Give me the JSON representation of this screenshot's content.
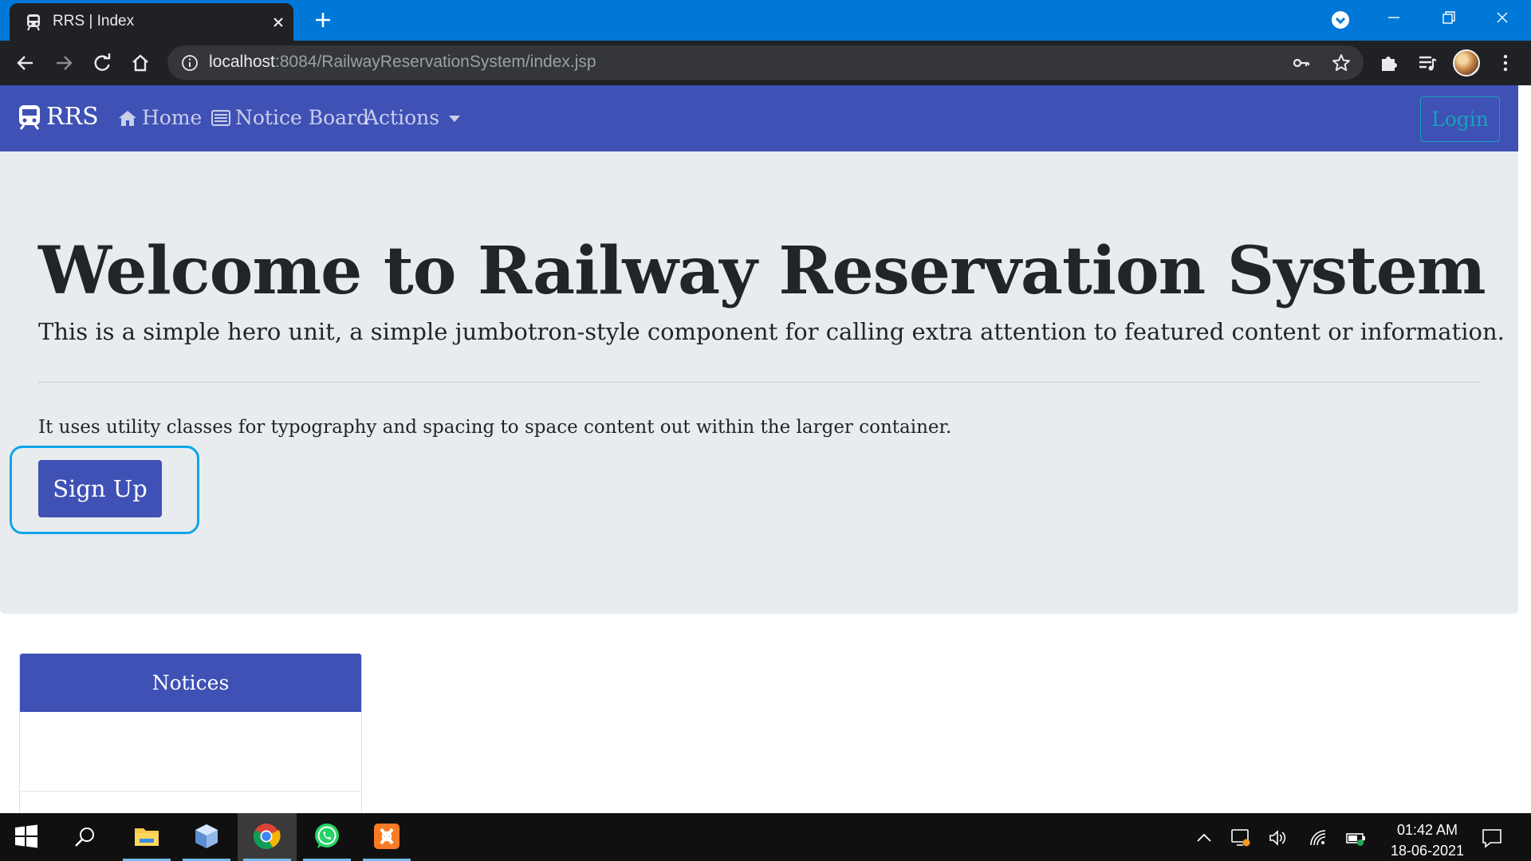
{
  "browser": {
    "tab_title": "RRS | Index",
    "url_host": "localhost",
    "url_rest": ":8084/RailwayReservationSystem/index.jsp"
  },
  "navbar": {
    "brand": "RRS",
    "links": [
      {
        "label": "Home",
        "icon": "home-icon"
      },
      {
        "label": "Notice Board",
        "icon": "list-alt-icon"
      },
      {
        "label": "Actions",
        "icon": "caret-down-icon"
      }
    ],
    "login_label": "Login"
  },
  "hero": {
    "title": "Welcome to Railway Reservation System",
    "lead": "This is a simple hero unit, a simple jumbotron-style component for calling extra attention to featured content or information.",
    "text": "It uses utility classes for typography and spacing to space content out within the larger container.",
    "signup_label": "Sign Up"
  },
  "notices": {
    "header": "Notices"
  },
  "taskbar": {
    "apps": [
      "start-icon",
      "search-icon",
      "file-explorer-icon",
      "app-cube-icon",
      "chrome-icon",
      "whatsapp-icon",
      "xampp-icon"
    ],
    "time": "01:42 AM",
    "date": "18-06-2021"
  },
  "colors": {
    "navbar": "#3f51b5",
    "jumbotron": "#e9ecef",
    "login_outline": "#17a2b8",
    "focus_ring": "#0ea5e9",
    "titlebar": "#0078d7",
    "toolbar": "#202124"
  }
}
